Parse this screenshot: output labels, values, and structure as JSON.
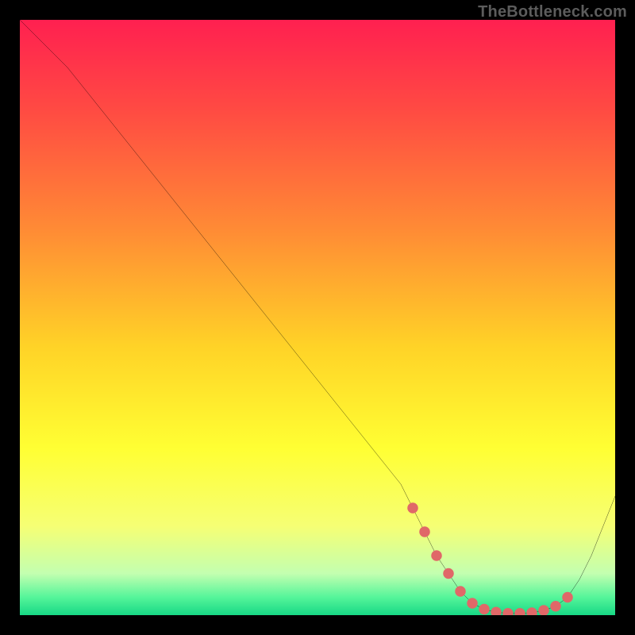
{
  "attribution": "TheBottleneck.com",
  "chart_data": {
    "type": "line",
    "title": "",
    "xlabel": "",
    "ylabel": "",
    "xlim": [
      0,
      100
    ],
    "ylim": [
      0,
      100
    ],
    "x": [
      0,
      4,
      8,
      12,
      16,
      20,
      24,
      28,
      32,
      36,
      40,
      44,
      48,
      52,
      56,
      60,
      64,
      66,
      68,
      70,
      72,
      74,
      76,
      78,
      80,
      82,
      84,
      86,
      88,
      90,
      92,
      94,
      96,
      98,
      100
    ],
    "values": [
      100,
      96,
      92,
      87,
      82,
      77,
      72,
      67,
      62,
      57,
      52,
      47,
      42,
      37,
      32,
      27,
      22,
      18,
      14,
      10,
      7,
      4,
      2,
      1,
      0.5,
      0.3,
      0.3,
      0.4,
      0.8,
      1.5,
      3,
      6,
      10,
      15,
      20
    ],
    "markers_x": [
      66,
      68,
      70,
      72,
      74,
      76,
      78,
      80,
      82,
      84,
      86,
      88,
      90,
      92
    ],
    "markers_values": [
      18,
      14,
      10,
      7,
      4,
      2,
      1,
      0.5,
      0.3,
      0.3,
      0.4,
      0.8,
      1.5,
      3
    ],
    "grid": false,
    "legend": false,
    "background_gradient_stops": [
      {
        "pos": 0.0,
        "color": "#ff2050"
      },
      {
        "pos": 0.15,
        "color": "#ff4a43"
      },
      {
        "pos": 0.35,
        "color": "#ff8a35"
      },
      {
        "pos": 0.55,
        "color": "#ffd327"
      },
      {
        "pos": 0.72,
        "color": "#ffff33"
      },
      {
        "pos": 0.85,
        "color": "#f6ff74"
      },
      {
        "pos": 0.93,
        "color": "#c3ffb0"
      },
      {
        "pos": 0.97,
        "color": "#55f59a"
      },
      {
        "pos": 1.0,
        "color": "#17d885"
      }
    ],
    "marker_color": "#e06868",
    "line_color": "#000000"
  }
}
